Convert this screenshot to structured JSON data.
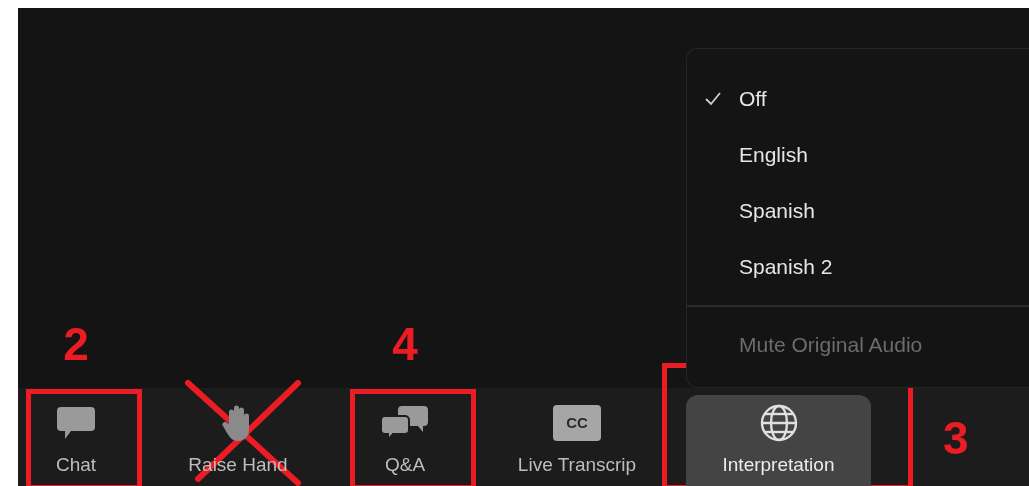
{
  "menu": {
    "items": [
      {
        "label": "Off",
        "selected": true,
        "disabled": false
      },
      {
        "label": "English",
        "selected": false,
        "disabled": false
      },
      {
        "label": "Spanish",
        "selected": false,
        "disabled": false
      },
      {
        "label": "Spanish 2",
        "selected": false,
        "disabled": false
      }
    ],
    "footer_item": {
      "label": "Mute Original Audio",
      "disabled": true
    }
  },
  "toolbar": [
    {
      "kind": "chat",
      "label": "Chat",
      "selected": false,
      "boxed": true,
      "crossed": false,
      "marker": {
        "kind": "above",
        "text": "2"
      }
    },
    {
      "kind": "hand",
      "label": "Raise Hand",
      "selected": false,
      "boxed": false,
      "crossed": true
    },
    {
      "kind": "qa",
      "label": "Q&A",
      "selected": false,
      "boxed": true,
      "crossed": false,
      "marker": {
        "kind": "above",
        "text": "4"
      }
    },
    {
      "kind": "cc",
      "label": "Live Transcrip",
      "badge": "CC",
      "selected": false,
      "boxed": false,
      "crossed": false
    },
    {
      "kind": "globe",
      "label": "Interpretation",
      "selected": true,
      "boxed": true,
      "crossed": false,
      "marker": {
        "kind": "right",
        "text": "3"
      }
    }
  ]
}
